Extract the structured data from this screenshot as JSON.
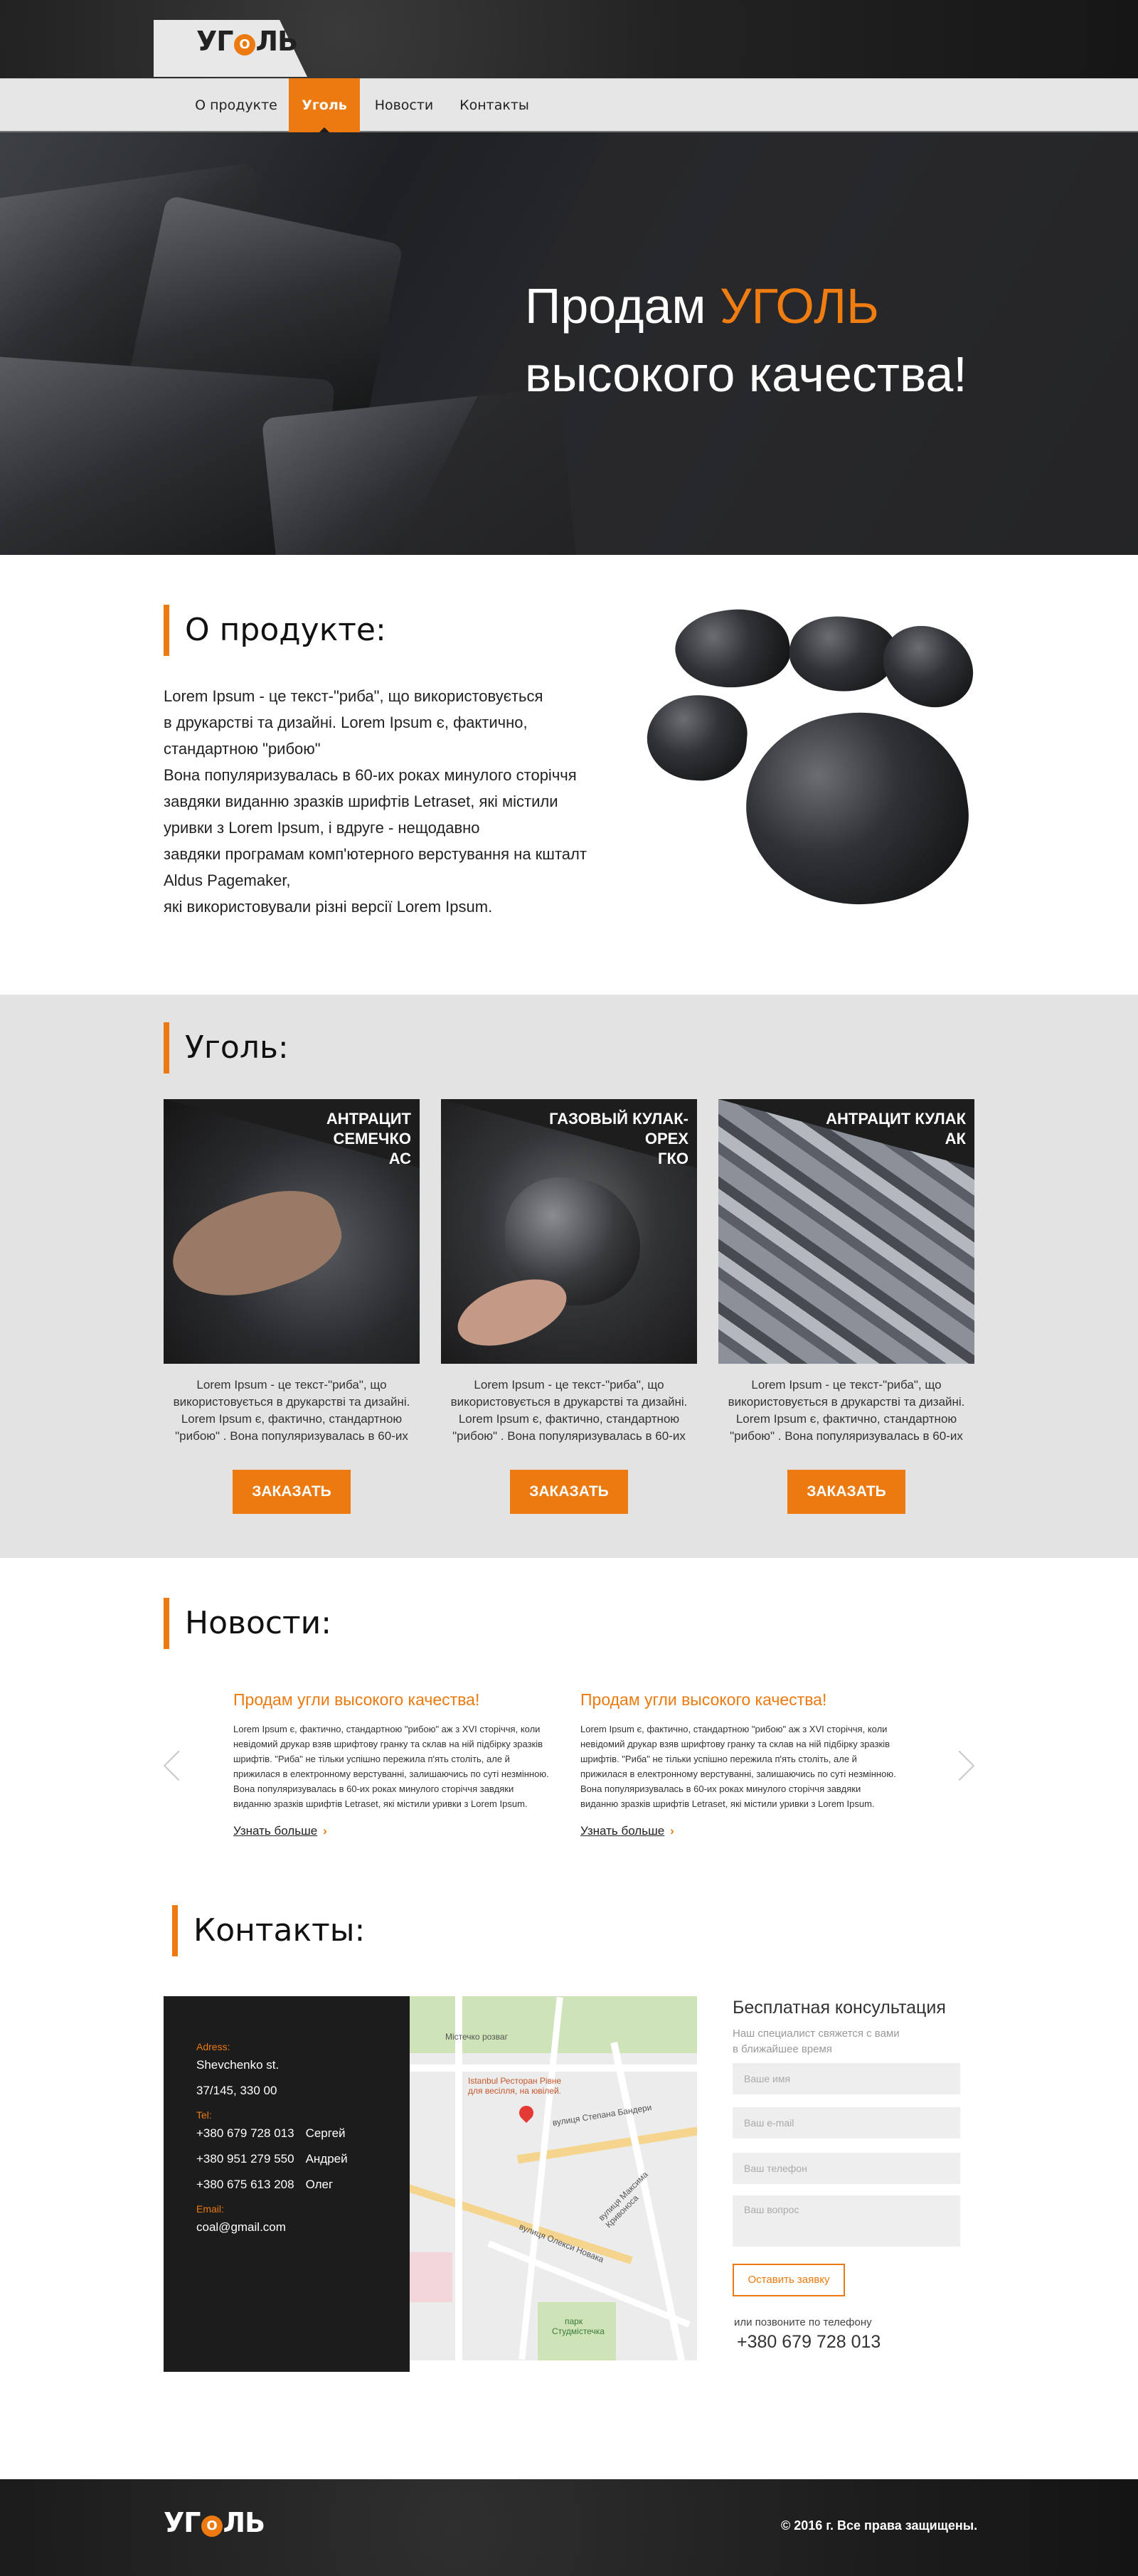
{
  "header": {
    "logo": {
      "text_before": "УГ",
      "logo_mark": "O",
      "text_after": "ЛЬ"
    },
    "nav": [
      {
        "label": "О продукте",
        "active": false
      },
      {
        "label": "Уголь",
        "active": true
      },
      {
        "label": "Новости",
        "active": false
      },
      {
        "label": "Контакты",
        "active": false
      }
    ]
  },
  "hero": {
    "line1_prefix": "Продам ",
    "line1_highlight": "УГОЛЬ",
    "line2": "высокого качества!"
  },
  "about": {
    "heading": "О продукте:",
    "lines": [
      "Lorem Ipsum - це текст-\"риба\", що використовується",
      "в друкарстві та дизайні. Lorem Ipsum є, фактично,",
      "стандартною \"рибою\"",
      "Вона популяризувалась в 60-их роках минулого сторіччя",
      "завдяки виданню зразків шрифтів Letraset, які містили",
      "уривки з Lorem Ipsum, і вдруге - нещодавно",
      "завдяки програмам комп'ютерного верстування на кшталт",
      "Aldus Pagemaker,",
      "які використовували різні версії Lorem Ipsum."
    ]
  },
  "coal": {
    "heading": "Уголь:",
    "products": [
      {
        "title_line1": "АНТРАЦИТ СЕМЕЧКО",
        "title_line2": "АС",
        "desc": [
          "Lorem Ipsum - це текст-\"риба\", що",
          "використовується в друкарстві та дизайні.",
          "Lorem Ipsum є, фактично, стандартною",
          "\"рибою\" . Вона популяризувалась в 60-их"
        ],
        "button": "ЗАКАЗАТЬ"
      },
      {
        "title_line1": "ГАЗОВЫЙ КУЛАК-ОРЕХ",
        "title_line2": "ГКО",
        "desc": [
          "Lorem Ipsum - це текст-\"риба\", що",
          "використовується в друкарстві та дизайні.",
          "Lorem Ipsum є, фактично, стандартною",
          "\"рибою\" . Вона популяризувалась в 60-их"
        ],
        "button": "ЗАКАЗАТЬ"
      },
      {
        "title_line1": "АНТРАЦИТ КУЛАК",
        "title_line2": "АК",
        "desc": [
          "Lorem Ipsum - це текст-\"риба\", що",
          "використовується в друкарстві та дизайні.",
          "Lorem Ipsum є, фактично, стандартною",
          "\"рибою\" . Вона популяризувалась в 60-их"
        ],
        "button": "ЗАКАЗАТЬ"
      }
    ]
  },
  "news": {
    "heading": "Новости:",
    "items": [
      {
        "title": "Продам угли высокого качества!",
        "text": [
          "Lorem Ipsum є, фактично, стандартною \"рибою\" аж з XVI сторіччя, коли",
          "невідомий друкар взяв шрифтову гранку та склав на ній підбірку зразків",
          "шрифтів. \"Риба\" не тільки успішно пережила п'ять століть, але й",
          "прижилася в електронному верстуванні, залишаючись по суті незмінною.",
          "Вона популяризувалась в 60-их роках минулого сторіччя завдяки",
          "виданню зразків шрифтів Letraset, які містили уривки з Lorem Ipsum."
        ],
        "more": "Узнать больше"
      },
      {
        "title": "Продам угли высокого качества!",
        "text": [
          "Lorem Ipsum є, фактично, стандартною \"рибою\" аж з XVI сторіччя, коли",
          "невідомий друкар взяв шрифтову гранку та склав на ній підбірку зразків",
          "шрифтів. \"Риба\" не тільки успішно пережила п'ять століть, але й",
          "прижилася в електронному верстуванні, залишаючись по суті незмінною.",
          "Вона популяризувалась в 60-их роках минулого сторіччя завдяки",
          "виданню зразків шрифтів Letraset, які містили уривки з Lorem Ipsum."
        ],
        "more": "Узнать больше"
      }
    ]
  },
  "contacts": {
    "heading": "Контакты:",
    "address_label": "Adress:",
    "address_line1": "Shevchenko st.",
    "address_line2": "37/145, 330 00",
    "tel_label": "Tel:",
    "phones": [
      {
        "number": "+380 679 728 013",
        "name": "Сергей"
      },
      {
        "number": "+380 951 279 550",
        "name": "Андрей"
      },
      {
        "number": "+380 675 613 208",
        "name": "Олег"
      }
    ],
    "email_label": "Email:",
    "email": "coal@gmail.com",
    "map_labels": {
      "place1": "Містечко розваг",
      "place2_line1": "Istanbul Ресторан Рівне",
      "place2_line2": "для весілля, на ювілей.",
      "street1": "вулиця Степана Бандери",
      "street2": "вулиця Олекси Новака",
      "street3": "вулиця Максима Кривоноса",
      "park_line1": "парк",
      "park_line2": "Студмістечка"
    },
    "consult_title": "Бесплатная консультация",
    "consult_sub_line1": "Наш специалист свяжется с вами",
    "consult_sub_line2": "в ближайшее время",
    "placeholders": {
      "name": "Ваше имя",
      "email": "Ваш e-mail",
      "phone": "Ваш телефон",
      "question": "Ваш вопрос"
    },
    "submit": "Оставить заявку",
    "call_text": "или позвоните по телефону",
    "call_phone": "+380 679 728 013"
  },
  "footer": {
    "copyright": "©   2016 г. Все права защищены."
  },
  "colors": {
    "accent": "#ec7a10",
    "dark": "#1c1c1c",
    "products_bg": "#e3e3e3"
  }
}
